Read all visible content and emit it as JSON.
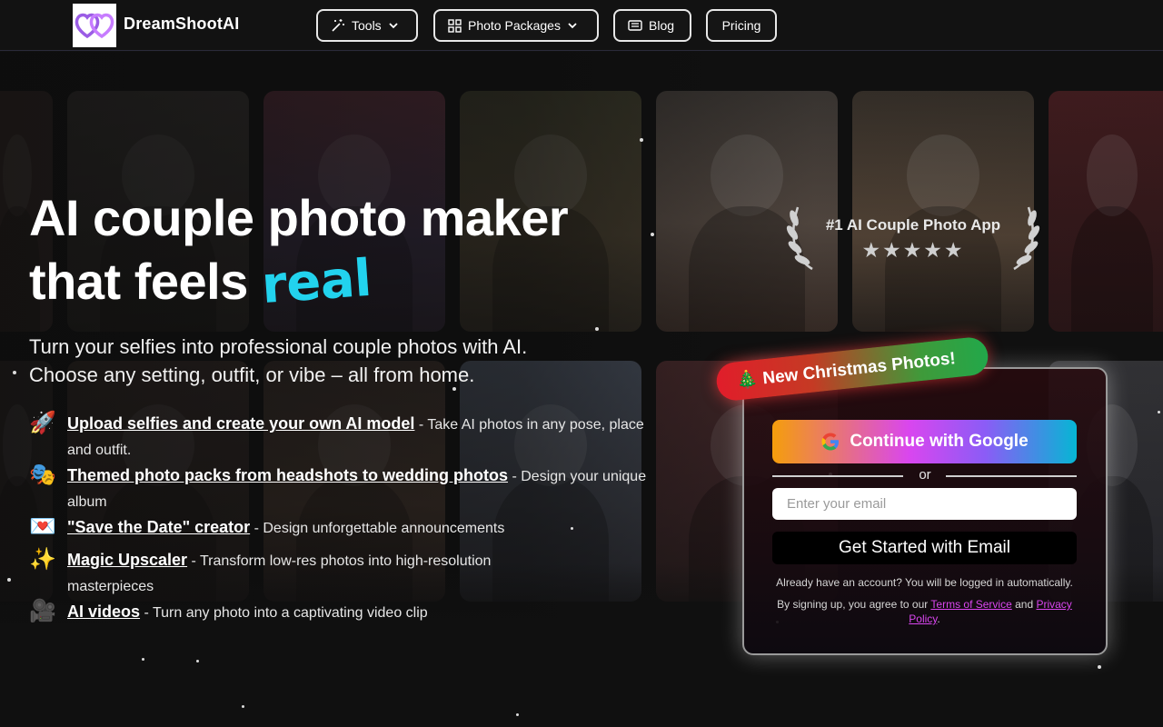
{
  "brand": {
    "name": "DreamShootAI"
  },
  "nav": {
    "tools": "Tools",
    "photo_packages": "Photo Packages",
    "blog": "Blog",
    "pricing": "Pricing"
  },
  "hero": {
    "headline_1": "AI couple photo maker",
    "headline_2": "that feels ",
    "headline_highlight": "real",
    "subtitle_1": "Turn your selfies into professional couple photos with AI.",
    "subtitle_2": "Choose any setting, outfit, or vibe – all from home."
  },
  "features": [
    {
      "emoji": "🚀",
      "link": "Upload selfies and create your own AI model",
      "desc": " - Take AI photos in any pose, place and outfit."
    },
    {
      "emoji": "🎭",
      "link": "Themed photo packs from headshots to wedding photos",
      "desc": " - Design your unique album"
    },
    {
      "emoji": "💌",
      "link": "\"Save the Date\" creator",
      "desc": " - Design unforgettable announcements"
    },
    {
      "emoji": "✨",
      "link": "Magic Upscaler",
      "desc": " - Transform low-res photos into high-resolution masterpieces"
    },
    {
      "emoji": "🎥",
      "link": "AI videos",
      "desc": " - Turn any photo into a captivating video clip"
    }
  ],
  "award": {
    "text": "#1 AI Couple Photo App",
    "rating": 5,
    "stars": "★★★★★"
  },
  "signup": {
    "ribbon": "🎄 New Christmas Photos!",
    "google": "Continue with Google",
    "or": "or",
    "email_placeholder": "Enter your email",
    "email_button": "Get Started with Email",
    "already": "Already have an account? You will be logged in automatically.",
    "terms_prefix": "By signing up, you agree to our ",
    "terms": "Terms of Service",
    "and": " and ",
    "privacy": "Privacy Policy",
    "period": "."
  },
  "colors": {
    "accent": "#22d3ee",
    "link": "#d946ef",
    "background": "#111111"
  }
}
